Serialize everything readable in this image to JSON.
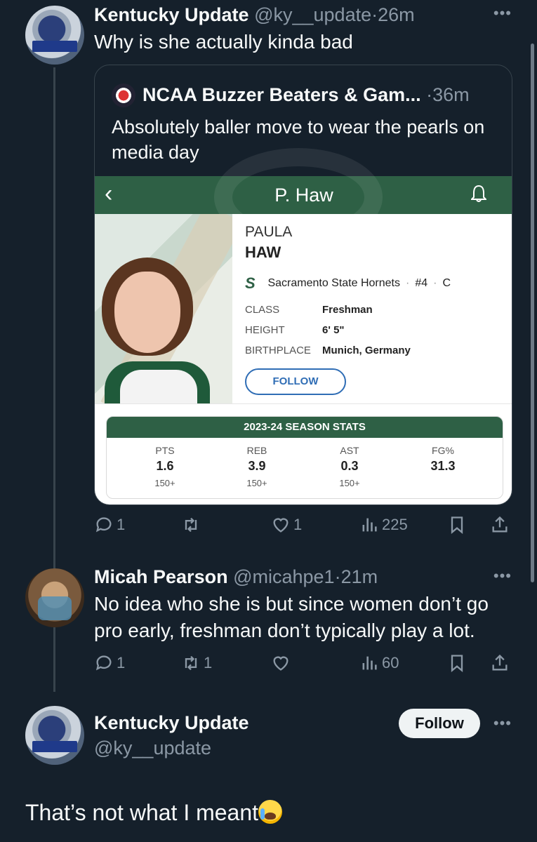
{
  "tweet1": {
    "name": "Kentucky Update",
    "handle": "@ky__update",
    "time": "26m",
    "text": "Why is she actually kinda bad",
    "replies": "1",
    "retweets": "",
    "likes": "1",
    "views": "225"
  },
  "quote": {
    "name": "NCAA Buzzer Beaters & Gam...",
    "time": "36m",
    "text": "Absolutely baller move to wear the pearls on media day",
    "card": {
      "bar_title": "P. Haw",
      "first_name": "PAULA",
      "last_name": "HAW",
      "team": "Sacramento State Hornets",
      "number": "#4",
      "position": "C",
      "info": [
        {
          "label": "CLASS",
          "value": "Freshman"
        },
        {
          "label": "HEIGHT",
          "value": "6' 5\""
        },
        {
          "label": "BIRTHPLACE",
          "value": "Munich, Germany"
        }
      ],
      "follow_label": "FOLLOW",
      "stats_title": "2023-24 SEASON STATS",
      "stats": [
        {
          "label": "PTS",
          "value": "1.6",
          "rank": "150+"
        },
        {
          "label": "REB",
          "value": "3.9",
          "rank": "150+"
        },
        {
          "label": "AST",
          "value": "0.3",
          "rank": "150+"
        },
        {
          "label": "FG%",
          "value": "31.3",
          "rank": ""
        }
      ]
    }
  },
  "tweet2": {
    "name": "Micah Pearson",
    "handle": "@micahpe1",
    "time": "21m",
    "text": "No idea who she is but since women don’t go pro early, freshman don’t typically play a lot.",
    "replies": "1",
    "retweets": "1",
    "likes": "",
    "views": "60"
  },
  "tweet3": {
    "name": "Kentucky Update",
    "handle": "@ky__update",
    "follow_label": "Follow",
    "text": "That’s not what I meant"
  },
  "ui": {
    "dot_sep": "·",
    "more": "•••"
  },
  "colors": {
    "background": "#15202b",
    "muted": "#8b98a5",
    "team_green": "#2e6045",
    "link_blue": "#2f6db5"
  }
}
